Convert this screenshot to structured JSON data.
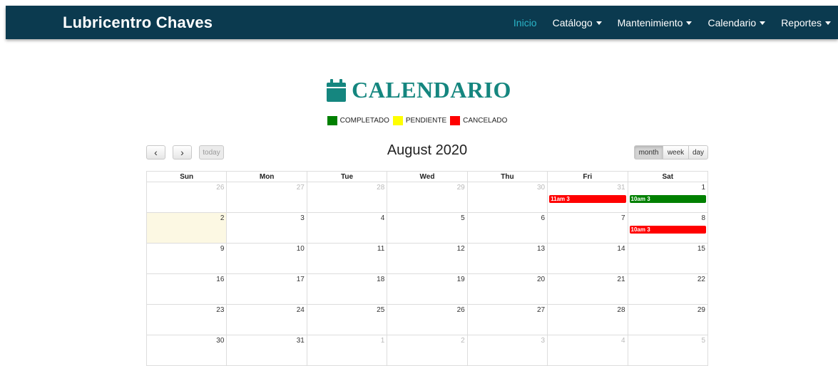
{
  "navbar": {
    "brand": "Lubricentro Chaves",
    "items": [
      {
        "label": "Inicio",
        "active": true,
        "dropdown": false
      },
      {
        "label": "Catálogo",
        "active": false,
        "dropdown": true
      },
      {
        "label": "Mantenimiento",
        "active": false,
        "dropdown": true
      },
      {
        "label": "Calendario",
        "active": false,
        "dropdown": true
      },
      {
        "label": "Reportes",
        "active": false,
        "dropdown": true
      }
    ],
    "background": "#0b3a4f",
    "active_color": "#2ab5c9"
  },
  "page": {
    "title": "CALENDARIO",
    "icon": "calendar-icon",
    "title_color": "#15867f"
  },
  "legend": [
    {
      "label": "COMPLETADO",
      "color": "#008000"
    },
    {
      "label": "PENDIENTE",
      "color": "#ffff00"
    },
    {
      "label": "CANCELADO",
      "color": "#ff0000"
    }
  ],
  "toolbar": {
    "prev_label": "‹",
    "next_label": "›",
    "today_label": "today",
    "heading": "August 2020",
    "views": [
      {
        "label": "month",
        "active": true
      },
      {
        "label": "week",
        "active": false
      },
      {
        "label": "day",
        "active": false
      }
    ]
  },
  "calendar": {
    "weekdays": [
      "Sun",
      "Mon",
      "Tue",
      "Wed",
      "Thu",
      "Fri",
      "Sat"
    ],
    "weeks": [
      [
        {
          "d": "26",
          "other": true
        },
        {
          "d": "27",
          "other": true
        },
        {
          "d": "28",
          "other": true
        },
        {
          "d": "29",
          "other": true
        },
        {
          "d": "30",
          "other": true
        },
        {
          "d": "31",
          "other": true
        },
        {
          "d": "1",
          "other": false
        }
      ],
      [
        {
          "d": "2",
          "other": false,
          "today": true
        },
        {
          "d": "3",
          "other": false
        },
        {
          "d": "4",
          "other": false
        },
        {
          "d": "5",
          "other": false
        },
        {
          "d": "6",
          "other": false
        },
        {
          "d": "7",
          "other": false
        },
        {
          "d": "8",
          "other": false
        }
      ],
      [
        {
          "d": "9",
          "other": false
        },
        {
          "d": "10",
          "other": false
        },
        {
          "d": "11",
          "other": false
        },
        {
          "d": "12",
          "other": false
        },
        {
          "d": "13",
          "other": false
        },
        {
          "d": "14",
          "other": false
        },
        {
          "d": "15",
          "other": false
        }
      ],
      [
        {
          "d": "16",
          "other": false
        },
        {
          "d": "17",
          "other": false
        },
        {
          "d": "18",
          "other": false
        },
        {
          "d": "19",
          "other": false
        },
        {
          "d": "20",
          "other": false
        },
        {
          "d": "21",
          "other": false
        },
        {
          "d": "22",
          "other": false
        }
      ],
      [
        {
          "d": "23",
          "other": false
        },
        {
          "d": "24",
          "other": false
        },
        {
          "d": "25",
          "other": false
        },
        {
          "d": "26",
          "other": false
        },
        {
          "d": "27",
          "other": false
        },
        {
          "d": "28",
          "other": false
        },
        {
          "d": "29",
          "other": false
        }
      ],
      [
        {
          "d": "30",
          "other": false
        },
        {
          "d": "31",
          "other": false
        },
        {
          "d": "1",
          "other": true
        },
        {
          "d": "2",
          "other": true
        },
        {
          "d": "3",
          "other": true
        },
        {
          "d": "4",
          "other": true
        },
        {
          "d": "5",
          "other": true
        }
      ]
    ],
    "events": [
      {
        "week": 0,
        "day": 5,
        "label": "11am 3",
        "color": "#ff0000"
      },
      {
        "week": 0,
        "day": 6,
        "label": "10am 3",
        "color": "#008000"
      },
      {
        "week": 1,
        "day": 6,
        "label": "10am 3",
        "color": "#ff0000"
      }
    ]
  }
}
